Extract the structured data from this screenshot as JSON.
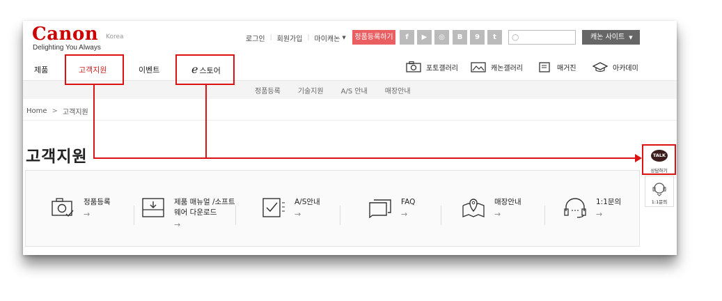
{
  "logo": {
    "wordmark": "Canon",
    "tagline": "Delighting You Always",
    "region": "Korea"
  },
  "utility": {
    "login": "로그인",
    "signup": "회원가입",
    "mypage": "마이캐논",
    "register_button": "정품등록하기",
    "sns": [
      "f",
      "▶",
      "◎",
      "B",
      "9",
      "t"
    ],
    "search_placeholder": "",
    "site_button": "캐논 사이트"
  },
  "nav": {
    "items": [
      "제품",
      "고객지원",
      "이벤트",
      "스토어"
    ],
    "estore_prefix": "e",
    "active": "고객지원",
    "services": [
      "포토갤러리",
      "캐논갤러리",
      "매거진",
      "아카데미"
    ]
  },
  "subnav": [
    "정품등록",
    "기술지원",
    "A/S 안내",
    "매장안내"
  ],
  "breadcrumb": {
    "home": "Home",
    "separator": ">",
    "current": "고객지원"
  },
  "page_title": "고객지원",
  "support_services": [
    {
      "line1": "정품등록",
      "line2": "",
      "icon": "camera-check-icon"
    },
    {
      "line1": "제품 매뉴얼 /소프트",
      "line2": "웨어 다운로드",
      "icon": "download-tray-icon"
    },
    {
      "line1": "A/S안내",
      "line2": "",
      "icon": "checklist-icon"
    },
    {
      "line1": "FAQ",
      "line2": "",
      "icon": "chat-bubbles-icon"
    },
    {
      "line1": "매장안내",
      "line2": "",
      "icon": "map-pin-icon"
    },
    {
      "line1": "1:1문의",
      "line2": "",
      "icon": "headset-icon"
    }
  ],
  "arrow_glyph": "→",
  "floating": {
    "talk_badge": "TALK",
    "talk_label": "상담하기",
    "chat_label": "1:1문의"
  },
  "colors": {
    "brand_red": "#cc0000",
    "annotation_red": "#dd1111",
    "register_pink": "#e95f62",
    "kakao_brown": "#3c1e1e"
  }
}
